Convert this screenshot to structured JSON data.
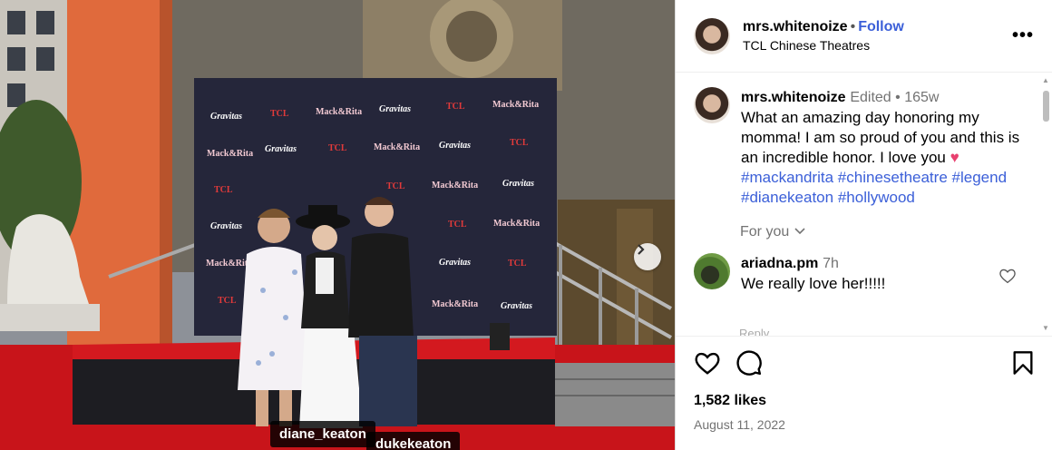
{
  "post": {
    "author": "mrs.whitenoize",
    "follow_label": "Follow",
    "location": "TCL Chinese Theatres",
    "more_label": "•••"
  },
  "media": {
    "tags": [
      "diane_keaton",
      "dukekeaton"
    ],
    "backdrop_logos": [
      "Mack&Rita",
      "Gravitas",
      "TCL CHINESE THEATRES"
    ]
  },
  "caption": {
    "author": "mrs.whitenoize",
    "edited": "Edited",
    "age": "165w",
    "text": "What an amazing day honoring my momma! I am so proud of you and this is an incredible honor. I love you",
    "hashtags": [
      "#mackandrita",
      "#chinesetheatre",
      "#legend",
      "#dianekeaton",
      "#hollywood"
    ]
  },
  "for_you": "For you",
  "comment": {
    "author": "ariadna.pm",
    "age": "7h",
    "text": "We really love her!!!!!",
    "reply_label": "Reply"
  },
  "likes": "1,582 likes",
  "date": "August 11, 2022",
  "colors": {
    "link": "#3b5fd8",
    "heart": "#e8416f",
    "carpet": "#c8141a",
    "backdrop": "#2a2b3a"
  }
}
